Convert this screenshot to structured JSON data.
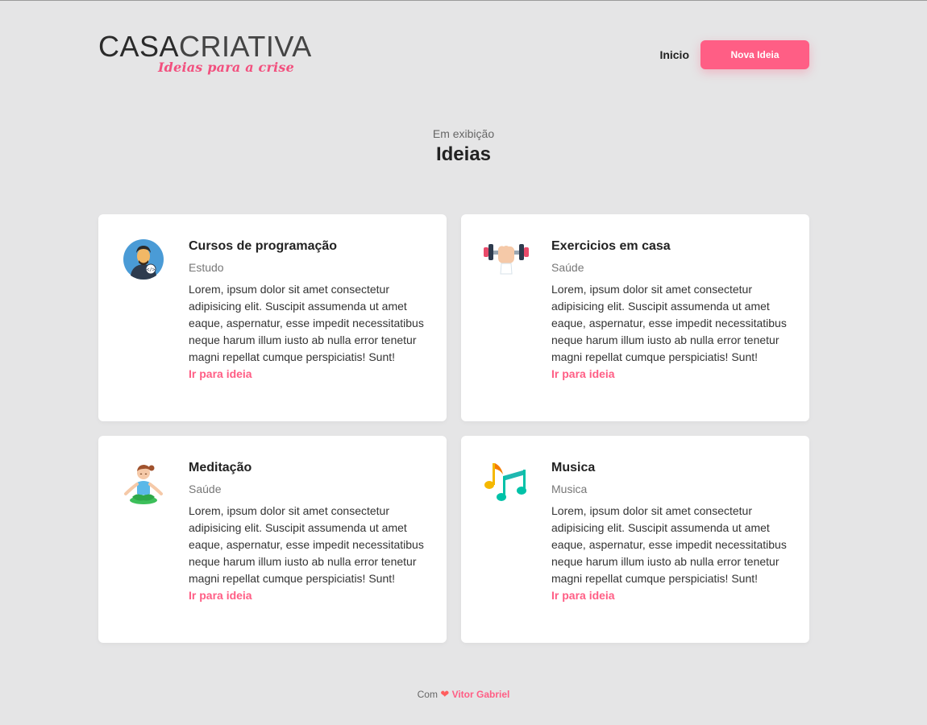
{
  "header": {
    "logo_main_bold": "CASA",
    "logo_main_light": "CRIATIVA",
    "logo_tagline": "Ideias para a crise",
    "nav_home": "Inicio",
    "new_idea_button": "Nova Ideia"
  },
  "section": {
    "eyebrow": "Em exibição",
    "title": "Ideias"
  },
  "ideas": [
    {
      "icon": "programmer-icon",
      "title": "Cursos de programação",
      "category": "Estudo",
      "description": "Lorem, ipsum dolor sit amet consectetur adipisicing elit. Suscipit assumenda ut amet eaque, aspernatur, esse impedit necessitatibus neque harum illum iusto ab nulla error tenetur magni repellat cumque perspiciatis! Sunt!",
      "link": "Ir para ideia"
    },
    {
      "icon": "dumbbell-icon",
      "title": "Exercicios em casa",
      "category": "Saúde",
      "description": "Lorem, ipsum dolor sit amet consectetur adipisicing elit. Suscipit assumenda ut amet eaque, aspernatur, esse impedit necessitatibus neque harum illum iusto ab nulla error tenetur magni repellat cumque perspiciatis! Sunt!",
      "link": "Ir para ideia"
    },
    {
      "icon": "meditation-icon",
      "title": "Meditação",
      "category": "Saúde",
      "description": "Lorem, ipsum dolor sit amet consectetur adipisicing elit. Suscipit assumenda ut amet eaque, aspernatur, esse impedit necessitatibus neque harum illum iusto ab nulla error tenetur magni repellat cumque perspiciatis! Sunt!",
      "link": "Ir para ideia"
    },
    {
      "icon": "music-notes-icon",
      "title": "Musica",
      "category": "Musica",
      "description": "Lorem, ipsum dolor sit amet consectetur adipisicing elit. Suscipit assumenda ut amet eaque, aspernatur, esse impedit necessitatibus neque harum illum iusto ab nulla error tenetur magni repellat cumque perspiciatis! Sunt!",
      "link": "Ir para ideia"
    }
  ],
  "footer": {
    "prefix": "Com",
    "author": "Vitor Gabriel"
  },
  "colors": {
    "background": "#e5e5e6",
    "accent": "#ff5e85",
    "card": "#ffffff"
  }
}
